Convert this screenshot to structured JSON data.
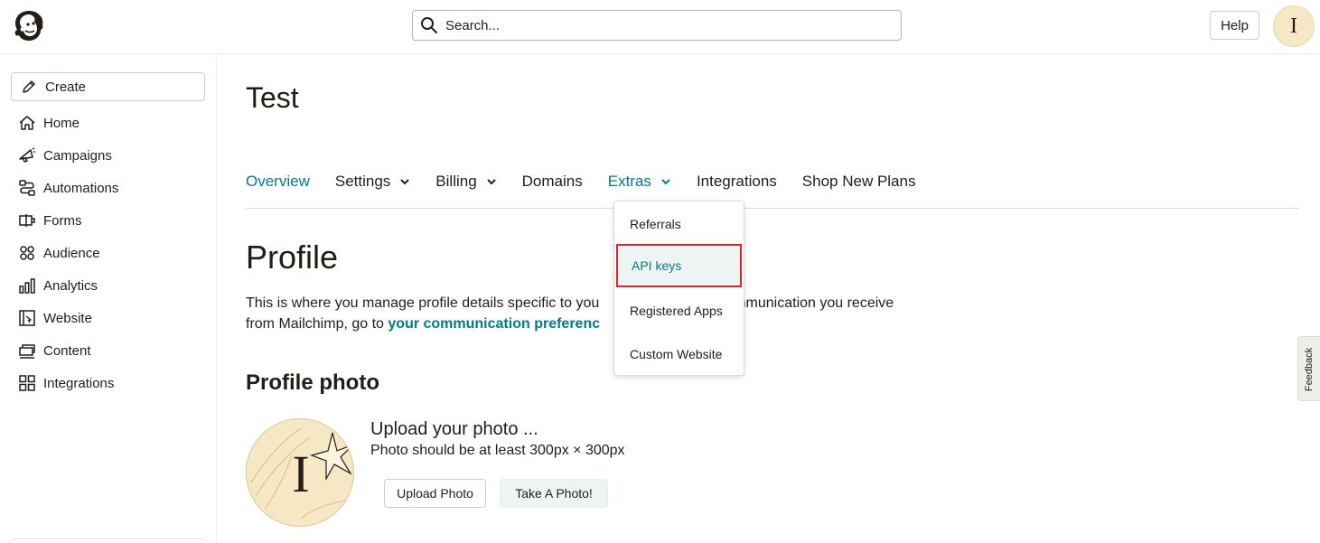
{
  "header": {
    "search_placeholder": "Search...",
    "help_label": "Help",
    "avatar_initial": "I"
  },
  "sidebar": {
    "create_label": "Create",
    "items": [
      {
        "label": "Home",
        "icon": "home-icon"
      },
      {
        "label": "Campaigns",
        "icon": "campaigns-icon"
      },
      {
        "label": "Automations",
        "icon": "automations-icon"
      },
      {
        "label": "Forms",
        "icon": "forms-icon"
      },
      {
        "label": "Audience",
        "icon": "audience-icon"
      },
      {
        "label": "Analytics",
        "icon": "analytics-icon"
      },
      {
        "label": "Website",
        "icon": "website-icon"
      },
      {
        "label": "Content",
        "icon": "content-icon"
      },
      {
        "label": "Integrations",
        "icon": "integrations-icon"
      }
    ]
  },
  "main": {
    "page_title": "Test",
    "tabs": [
      {
        "label": "Overview"
      },
      {
        "label": "Settings"
      },
      {
        "label": "Billing"
      },
      {
        "label": "Domains"
      },
      {
        "label": "Extras"
      },
      {
        "label": "Integrations"
      },
      {
        "label": "Shop New Plans"
      }
    ],
    "profile_title": "Profile",
    "profile_desc_1": "This is where you manage profile details specific to you",
    "profile_desc_2": "communication you receive",
    "profile_desc_3": "from Mailchimp, go to ",
    "profile_desc_link": "your communication preferenc",
    "photo_title": "Profile photo",
    "avatar_initial": "I",
    "upload_heading": "Upload your photo ...",
    "upload_sub": "Photo should be at least 300px × 300px",
    "upload_button": "Upload Photo",
    "take_photo_button": "Take A Photo!"
  },
  "dropdown": {
    "items": [
      {
        "label": "Referrals"
      },
      {
        "label": "API keys"
      },
      {
        "label": "Registered Apps"
      },
      {
        "label": "Custom Website"
      }
    ]
  },
  "feedback_label": "Feedback",
  "colors": {
    "accent": "#007c89",
    "text": "#241c15",
    "highlight_border": "#e0232a"
  }
}
